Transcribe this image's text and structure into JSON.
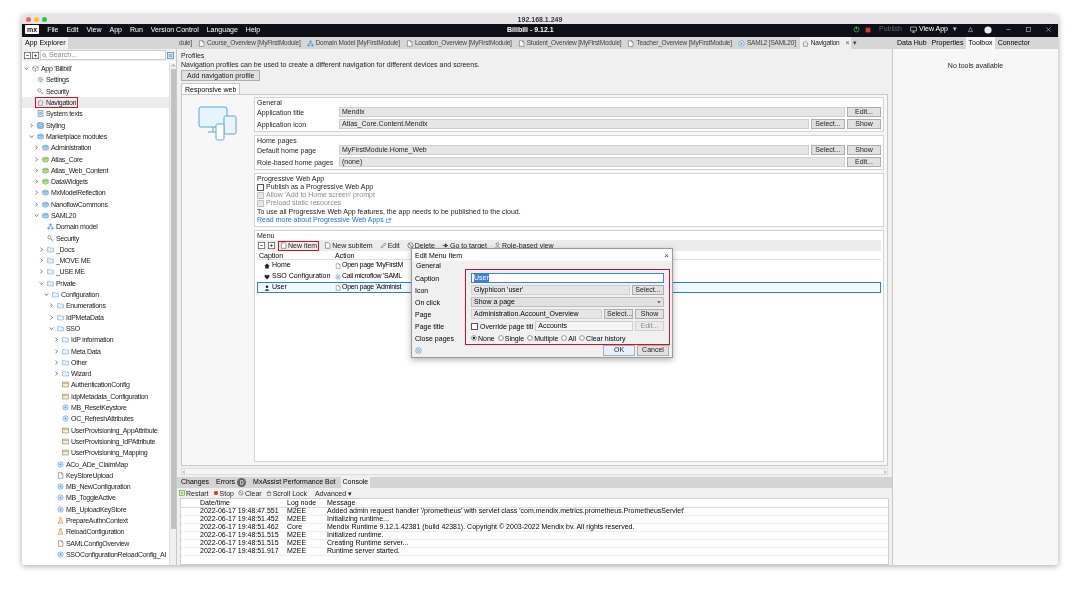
{
  "window": {
    "title": "192.168.1.249"
  },
  "menu_bar": {
    "logo": "mx",
    "items": [
      "File",
      "Edit",
      "View",
      "App",
      "Run",
      "Version Control",
      "Language",
      "Help"
    ],
    "title": "Bilibili - 9.12.1",
    "publish": "Publish",
    "view_app": "View App",
    "dropdown": "▾"
  },
  "document_tabs": [
    {
      "label": "dule]",
      "kind": "cut",
      "selected": false
    },
    {
      "label": "Course_Overview [MyFirstModule]",
      "kind": "page",
      "selected": false
    },
    {
      "label": "Domain Model [MyFirstModule]",
      "kind": "domain",
      "selected": false
    },
    {
      "label": "Location_Overview [MyFirstModule]",
      "kind": "page",
      "selected": false
    },
    {
      "label": "Student_Overview [MyFirstModule]",
      "kind": "page",
      "selected": false
    },
    {
      "label": "Teacher_Overview [MyFirstModule]",
      "kind": "page",
      "selected": false
    },
    {
      "label": "SAML2 [SAML20]",
      "kind": "microflow",
      "selected": false
    },
    {
      "label": "Navigation",
      "kind": "navigation",
      "selected": true,
      "close": "×"
    }
  ],
  "tab_overflow": "▾",
  "left_panel": {
    "title": "App Explorer",
    "search": {
      "placeholder": "Search..."
    },
    "tree": [
      {
        "label": "App 'Bilibili'",
        "kind": "app",
        "expanded": true,
        "children": [
          {
            "label": "Settings",
            "kind": "settings"
          },
          {
            "label": "Security",
            "kind": "security"
          },
          {
            "label": "Navigation",
            "kind": "navigation",
            "highlighted": true
          },
          {
            "label": "System texts",
            "kind": "texts"
          },
          {
            "label": "Styling",
            "kind": "styling",
            "expanded": false
          },
          {
            "label": "Marketplace modules",
            "kind": "module",
            "expanded": true,
            "children": [
              {
                "label": "Administration",
                "kind": "module",
                "expanded": false
              },
              {
                "label": "Atlas_Core",
                "kind": "theme",
                "expanded": false
              },
              {
                "label": "Atlas_Web_Content",
                "kind": "theme",
                "expanded": false
              },
              {
                "label": "DataWidgets",
                "kind": "theme",
                "expanded": false
              },
              {
                "label": "MxModelReflection",
                "kind": "module",
                "expanded": false
              },
              {
                "label": "NanoflowCommons",
                "kind": "module",
                "expanded": false
              },
              {
                "label": "SAML20",
                "kind": "module",
                "expanded": true,
                "children": [
                  {
                    "label": "Domain model",
                    "kind": "domain"
                  },
                  {
                    "label": "Security",
                    "kind": "security"
                  },
                  {
                    "label": "_Docs",
                    "kind": "folder",
                    "expanded": false
                  },
                  {
                    "label": "_MOVE ME",
                    "kind": "folder",
                    "expanded": false
                  },
                  {
                    "label": "_USE ME",
                    "kind": "folder",
                    "expanded": false
                  },
                  {
                    "label": "Private",
                    "kind": "folder",
                    "expanded": true,
                    "children": [
                      {
                        "label": "Configuration",
                        "kind": "folder",
                        "expanded": true,
                        "children": [
                          {
                            "label": "Enumerations",
                            "kind": "folder",
                            "expanded": false
                          },
                          {
                            "label": "IdPMetaData",
                            "kind": "folder",
                            "expanded": false
                          },
                          {
                            "label": "SSO",
                            "kind": "folder",
                            "expanded": true,
                            "children": [
                              {
                                "label": "IdP information",
                                "kind": "folder",
                                "expanded": false
                              },
                              {
                                "label": "Meta Data",
                                "kind": "folder",
                                "expanded": false
                              },
                              {
                                "label": "Other",
                                "kind": "folder",
                                "expanded": false
                              },
                              {
                                "label": "Wizard",
                                "kind": "folder",
                                "expanded": false
                              },
                              {
                                "label": "AuthenticationConfig",
                                "kind": "snippet"
                              },
                              {
                                "label": "IdpMetadata_Configuration",
                                "kind": "snippet"
                              },
                              {
                                "label": "MB_ResetKeystore",
                                "kind": "microflow"
                              },
                              {
                                "label": "OC_RefreshAttributes",
                                "kind": "microflow"
                              },
                              {
                                "label": "UserProvisioning_AppAttribute",
                                "kind": "snippet"
                              },
                              {
                                "label": "UserProvisioning_IdPAttribute",
                                "kind": "snippet"
                              },
                              {
                                "label": "UserProvisioning_Mapping",
                                "kind": "snippet"
                              }
                            ]
                          },
                          {
                            "label": "ACo_ADe_ClaimMap",
                            "kind": "microflow"
                          },
                          {
                            "label": "KeyStoreUpload",
                            "kind": "page"
                          },
                          {
                            "label": "MB_NewConfiguration",
                            "kind": "microflow"
                          },
                          {
                            "label": "MB_ToggleActive",
                            "kind": "microflow"
                          },
                          {
                            "label": "MB_UploadKeyStore",
                            "kind": "microflow"
                          },
                          {
                            "label": "PrepareAuthnContext",
                            "kind": "java"
                          },
                          {
                            "label": "ReloadConfiguration",
                            "kind": "java"
                          },
                          {
                            "label": "SAMLConfigOverview",
                            "kind": "page"
                          },
                          {
                            "label": "SSOConfigurationReloadConfig_AI",
                            "kind": "microflow"
                          }
                        ]
                      }
                    ]
                  }
                ]
              }
            ]
          }
        ]
      }
    ]
  },
  "profiles": {
    "title": "Profiles",
    "description": "Navigation profiles can be used to create a different navigation for different devices and screens.",
    "add_button": "Add navigation profile",
    "tabs": [
      {
        "label": "Responsive web",
        "selected": true
      }
    ]
  },
  "general": {
    "title": "General",
    "rows": [
      {
        "label": "Application title",
        "value": "Mendix",
        "buttons": [
          "Edit..."
        ]
      },
      {
        "label": "Application icon",
        "value": "Atlas_Core.Content.Mendix",
        "buttons": [
          "Select...",
          "Show"
        ]
      }
    ]
  },
  "home_pages": {
    "title": "Home pages",
    "rows": [
      {
        "label": "Default home page",
        "value": "MyFirstModule.Home_Web",
        "buttons": [
          "Select...",
          "Show"
        ]
      },
      {
        "label": "Role-based home pages",
        "value": "(none)",
        "buttons": [
          "Edit..."
        ]
      }
    ]
  },
  "pwa": {
    "title": "Progressive Web App",
    "options": [
      {
        "label": "Publish as a Progressive Web App",
        "checked": false,
        "disabled": false
      },
      {
        "label": "Allow 'Add to Home screen' prompt",
        "checked": false,
        "disabled": true
      },
      {
        "label": "Preload static resources",
        "checked": false,
        "disabled": true
      }
    ],
    "note": "To use all Progressive Web App features, the app needs to be published to the cloud.",
    "link": "Read more about Progressive Web Apps"
  },
  "menu": {
    "title": "Menu",
    "toolbar": [
      {
        "kind": "collapse",
        "highlighted": false
      },
      {
        "kind": "expand",
        "highlighted": false
      },
      {
        "label": "New item",
        "kind": "new",
        "highlighted": true
      },
      {
        "label": "New subitem",
        "kind": "new",
        "highlighted": false
      },
      {
        "label": "Edit",
        "kind": "edit",
        "highlighted": false
      },
      {
        "label": "Delete",
        "kind": "delete",
        "highlighted": false
      },
      {
        "label": "Go to target",
        "kind": "goto",
        "highlighted": false
      },
      {
        "label": "Role-based view",
        "kind": "roles",
        "highlighted": false
      }
    ],
    "columns": [
      "Caption",
      "Action"
    ],
    "rows": [
      {
        "caption": "Home",
        "action": "Open page 'MyFirstM",
        "kind": "page",
        "selected": false
      },
      {
        "caption": "SSO Configuration",
        "action": "Call microflow 'SAML",
        "kind": "microflow",
        "selected": false
      },
      {
        "caption": "User",
        "action": "Open page 'Administ",
        "kind": "page",
        "selected": true
      }
    ]
  },
  "dialog": {
    "title": "Edit Menu Item",
    "close": "×",
    "group": "General",
    "highlighted": true,
    "caption": {
      "label": "Caption",
      "value": "User"
    },
    "icon": {
      "label": "Icon",
      "value": "Glyphicon 'user'",
      "button": "Select..."
    },
    "on_click": {
      "label": "On click",
      "value": "Show a page"
    },
    "page": {
      "label": "Page",
      "value": "Administration.Account_Overview",
      "buttons": [
        "Select...",
        "Show"
      ]
    },
    "page_title": {
      "label": "Page title",
      "override": "Override page titl",
      "checked": false,
      "value": "Accounts",
      "button": "Edit..."
    },
    "close_pages": {
      "label": "Close pages",
      "options": [
        {
          "label": "None",
          "selected": true
        },
        {
          "label": "Single",
          "selected": false
        },
        {
          "label": "Multiple",
          "selected": false
        },
        {
          "label": "All",
          "selected": false
        },
        {
          "label": "Clear history",
          "selected": false
        }
      ]
    },
    "buttons": [
      {
        "label": "OK",
        "default": true
      },
      {
        "label": "Cancel",
        "default": false
      }
    ]
  },
  "console": {
    "tabs": [
      {
        "label": "Changes",
        "selected": false
      },
      {
        "label": "Errors",
        "badge": "0",
        "selected": false
      },
      {
        "label": "MxAssist Performance Bot",
        "selected": false
      },
      {
        "label": "Console",
        "selected": true
      }
    ],
    "toolbar": [
      {
        "label": "Restart",
        "kind": "restart"
      },
      {
        "label": "Stop",
        "kind": "stop"
      },
      {
        "label": "Clear",
        "kind": "clear"
      },
      {
        "label": "Scroll Lock",
        "kind": "lock"
      },
      {
        "label": "Advanced ▾",
        "kind": "menu"
      }
    ],
    "columns": [
      "Date/time",
      "Log node",
      "Message"
    ],
    "rows": [
      {
        "time": "2022-06-17 19:48:47.551",
        "node": "M2EE",
        "message": "Added admin request handler '/prometheus' with servlet class 'com.mendix.metrics.prometheus.PrometheusServlet'"
      },
      {
        "time": "2022-06-17 19:48:51.452",
        "node": "M2EE",
        "message": "Initializing runtime..."
      },
      {
        "time": "2022-06-17 19:48:51.462",
        "node": "Core",
        "message": "Mendix Runtime 9.12.1.42381 (build 42381). Copyright © 2003-2022 Mendix bv. All rights reserved."
      },
      {
        "time": "2022-06-17 19:48:51.515",
        "node": "M2EE",
        "message": "Initialized runtime."
      },
      {
        "time": "2022-06-17 19:48:51.515",
        "node": "M2EE",
        "message": "Creating Runtime server..."
      },
      {
        "time": "2022-06-17 19:48:51.917",
        "node": "M2EE",
        "message": "Runtime server started."
      }
    ]
  },
  "right_panel": {
    "tabs": [
      {
        "label": "Data Hub",
        "selected": false
      },
      {
        "label": "Properties",
        "selected": false
      },
      {
        "label": "Toolbox",
        "selected": true
      },
      {
        "label": "Connector",
        "selected": false
      }
    ],
    "message": "No tools available"
  }
}
